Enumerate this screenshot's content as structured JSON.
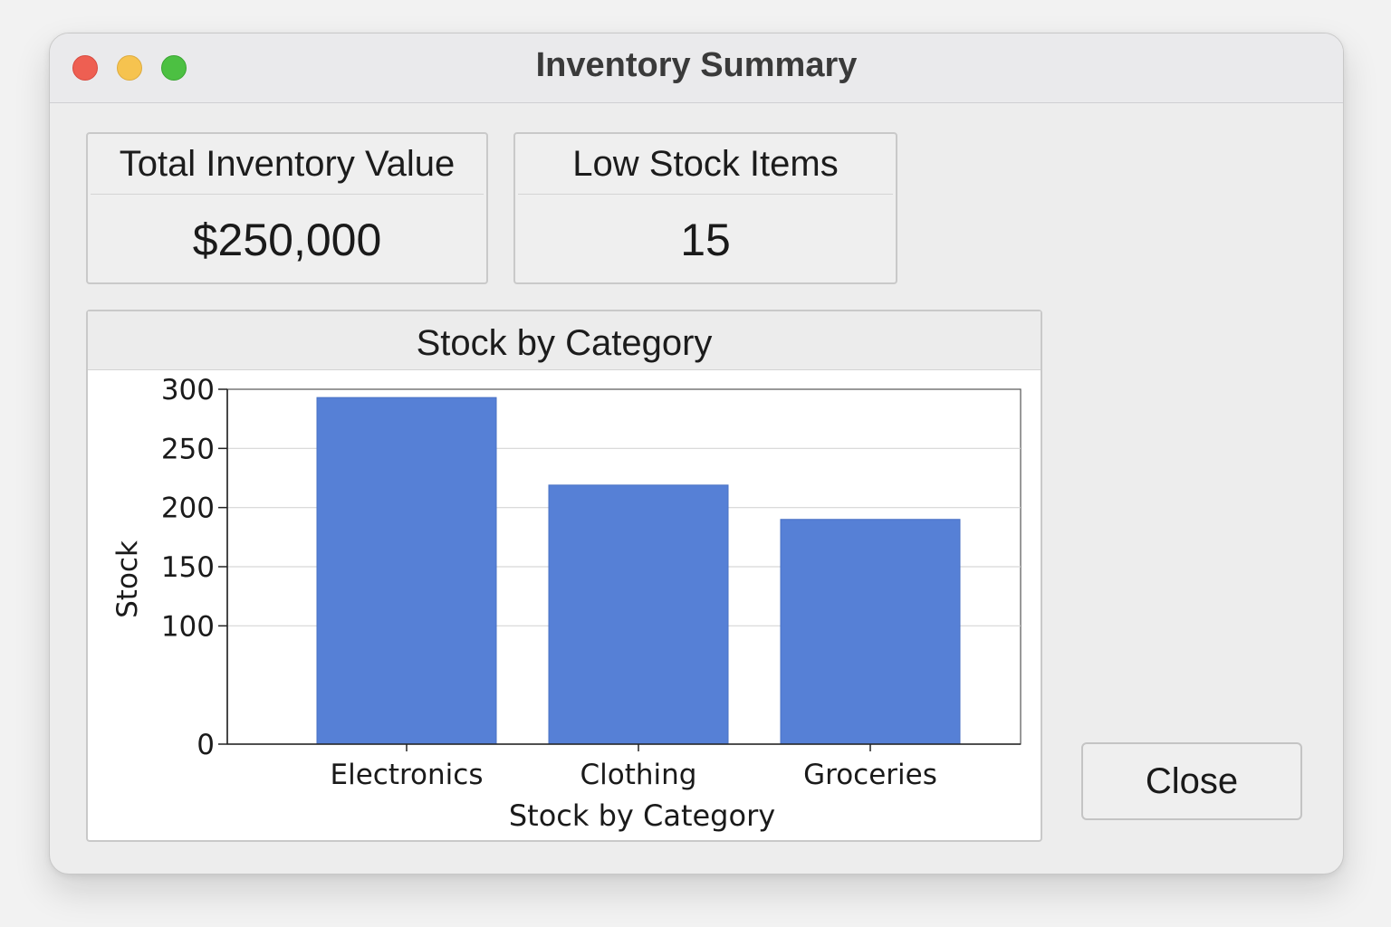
{
  "window": {
    "title": "Inventory Summary"
  },
  "cards": {
    "total_value": {
      "label": "Total Inventory Value",
      "value": "$250,000"
    },
    "low_stock": {
      "label": "Low Stock Items",
      "value": "15"
    }
  },
  "chart_panel": {
    "title": "Stock by Category"
  },
  "chart_data": {
    "type": "bar",
    "title": "Stock by Category",
    "categories": [
      "Electronics",
      "Clothing",
      "Groceries"
    ],
    "values": [
      293,
      219,
      190
    ],
    "xlabel": "Stock by Category",
    "ylabel": "Stock",
    "ylim": [
      0,
      300
    ],
    "yticks": [
      0,
      100,
      150,
      200,
      250,
      300
    ],
    "grid": true,
    "bar_color": "#5680d6"
  },
  "buttons": {
    "close_label": "Close"
  }
}
